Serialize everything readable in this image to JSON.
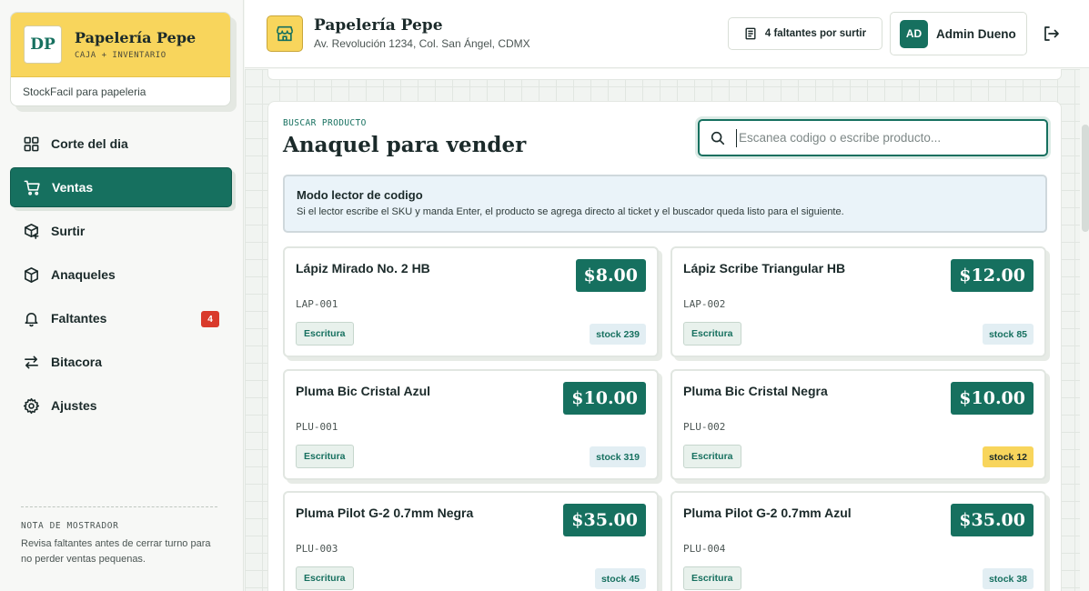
{
  "brand": {
    "logo_text": "DP",
    "name": "Papelería Pepe",
    "subtitle": "CAJA + INVENTARIO",
    "tagline": "StockFacil para papeleria"
  },
  "nav": {
    "items": [
      {
        "label": "Corte del dia",
        "icon": "grid-icon"
      },
      {
        "label": "Ventas",
        "icon": "cart-icon",
        "active": true
      },
      {
        "label": "Surtir",
        "icon": "box-plus-icon"
      },
      {
        "label": "Anaqueles",
        "icon": "box-icon"
      },
      {
        "label": "Faltantes",
        "icon": "bell-icon",
        "badge": "4"
      },
      {
        "label": "Bitacora",
        "icon": "arrows-icon"
      },
      {
        "label": "Ajustes",
        "icon": "gear-icon"
      }
    ]
  },
  "note": {
    "title": "NOTA DE MOSTRADOR",
    "body": "Revisa faltantes antes de cerrar turno para no perder ventas pequenas."
  },
  "header": {
    "store_name": "Papelería Pepe",
    "address": "Av. Revolución 1234, Col. San Ángel, CDMX",
    "missing_label": "4 faltantes por surtir",
    "user_initials": "AD",
    "user_name": "Admin Dueno"
  },
  "shelf": {
    "label": "BUSCAR PRODUCTO",
    "title": "Anaquel para vender",
    "search_placeholder": "Escanea codigo o escribe producto...",
    "info_title": "Modo lector de codigo",
    "info_body": "Si el lector escribe el SKU y manda Enter, el producto se agrega directo al ticket y el buscador queda listo para el siguiente."
  },
  "products": [
    {
      "name": "Lápiz Mirado No. 2 HB",
      "price": "$8.00",
      "sku": "LAP-001",
      "category": "Escritura",
      "stock": "stock 239",
      "low": false
    },
    {
      "name": "Lápiz Scribe Triangular HB",
      "price": "$12.00",
      "sku": "LAP-002",
      "category": "Escritura",
      "stock": "stock 85",
      "low": false
    },
    {
      "name": "Pluma Bic Cristal Azul",
      "price": "$10.00",
      "sku": "PLU-001",
      "category": "Escritura",
      "stock": "stock 319",
      "low": false
    },
    {
      "name": "Pluma Bic Cristal Negra",
      "price": "$10.00",
      "sku": "PLU-002",
      "category": "Escritura",
      "stock": "stock 12",
      "low": true
    },
    {
      "name": "Pluma Pilot G-2 0.7mm Negra",
      "price": "$35.00",
      "sku": "PLU-003",
      "category": "Escritura",
      "stock": "stock 45",
      "low": false
    },
    {
      "name": "Pluma Pilot G-2 0.7mm Azul",
      "price": "$35.00",
      "sku": "PLU-004",
      "category": "Escritura",
      "stock": "stock 38",
      "low": false
    }
  ],
  "colors": {
    "accent": "#16705f",
    "brand_yellow": "#f8d55c",
    "badge_red": "#d93a2b"
  }
}
